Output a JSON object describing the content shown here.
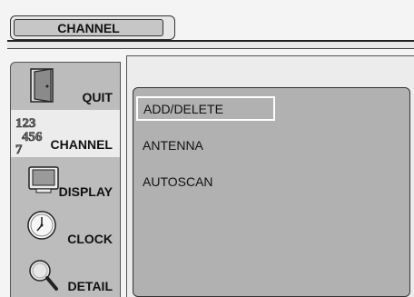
{
  "header": {
    "title": "CHANNEL"
  },
  "sidebar": {
    "items": [
      {
        "label": "QUIT",
        "icon": "door-icon",
        "selected": false
      },
      {
        "label": "CHANNEL",
        "icon": "channel-numbers-icon",
        "icon_text": "123456 7",
        "selected": true
      },
      {
        "label": "DISPLAY",
        "icon": "monitor-icon",
        "selected": false
      },
      {
        "label": "CLOCK",
        "icon": "clock-icon",
        "selected": false
      },
      {
        "label": "DETAIL",
        "icon": "magnifier-icon",
        "selected": false
      }
    ]
  },
  "menu": {
    "items": [
      {
        "label": "ADD/DELETE",
        "highlighted": true
      },
      {
        "label": "ANTENNA",
        "highlighted": false
      },
      {
        "label": "AUTOSCAN",
        "highlighted": false
      }
    ]
  },
  "colors": {
    "sidebar_bg": "#bcbcbc",
    "selected_bg": "#ececec",
    "panel_bg": "#b1b1b1",
    "highlight_border": "#ffffff"
  }
}
